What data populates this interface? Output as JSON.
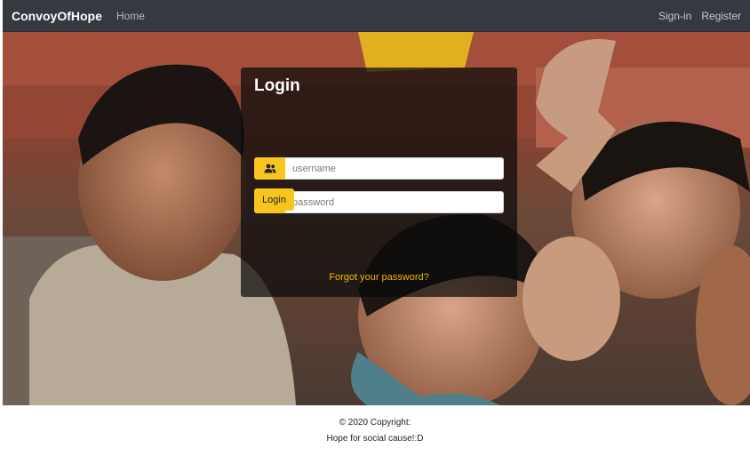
{
  "nav": {
    "brand": "ConvoyOfHope",
    "home": "Home",
    "signin": "Sign-in",
    "register": "Register"
  },
  "login": {
    "title": "Login",
    "username_placeholder": "username",
    "password_placeholder": "password",
    "button": "Login",
    "forgot": "Forgot your password?",
    "username_icon": "users-icon",
    "password_icon": "lock-icon"
  },
  "footer": {
    "copyright": "© 2020 Copyright:",
    "tagline": "Hope for social cause!:D"
  },
  "colors": {
    "navbar": "#343a40",
    "accent": "#f7c51e",
    "link": "#f0b900"
  }
}
